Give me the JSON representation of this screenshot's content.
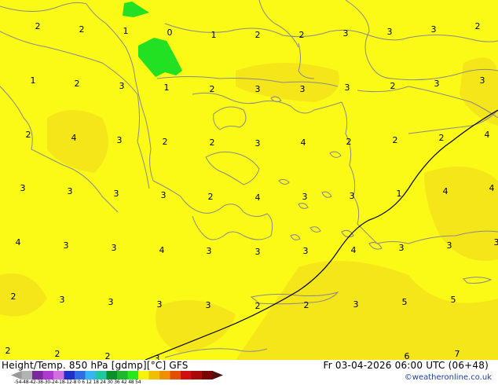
{
  "map": {
    "footer": {
      "title": "Height/Temp. 850 hPa [gdmp][°C] GFS",
      "valid": "Fr 03-04-2026 06:00 UTC (06+48)",
      "credit": "©weatheronline.co.uk",
      "colorbar_ticks": "-54-48-42-38-30-24-18-12-8  0  6  12 18 24 30 36 42 48 54"
    },
    "colorbar": {
      "colors": [
        "#9a9a9a",
        "#b3b3b3",
        "#7a2a9a",
        "#b03ad0",
        "#d070e0",
        "#1e30c8",
        "#2f6ee0",
        "#35b6f0",
        "#20c8a0",
        "#0a8f2a",
        "#1fb82c",
        "#26e81c",
        "#f5f50c",
        "#f0c000",
        "#f09000",
        "#e05000",
        "#d01010",
        "#a80a0a",
        "#7a0505",
        "#501010"
      ]
    },
    "colors": {
      "base": "#fafa16",
      "warm": "#f5e61a",
      "cold": "#22e022",
      "border": "#8a8a8a",
      "contour": "#000000"
    },
    "labels": [
      {
        "text": "2"
      },
      {
        "text": "2"
      },
      {
        "text": "1"
      },
      {
        "text": "0"
      },
      {
        "text": "1"
      },
      {
        "text": "2"
      },
      {
        "text": "2"
      },
      {
        "text": "3"
      },
      {
        "text": "3"
      },
      {
        "text": "3"
      },
      {
        "text": "2"
      },
      {
        "text": "1"
      },
      {
        "text": "2"
      },
      {
        "text": "3"
      },
      {
        "text": "1"
      },
      {
        "text": "2"
      },
      {
        "text": "3"
      },
      {
        "text": "3"
      },
      {
        "text": "3"
      },
      {
        "text": "2"
      },
      {
        "text": "3"
      },
      {
        "text": "3"
      },
      {
        "text": "2"
      },
      {
        "text": "4"
      },
      {
        "text": "3"
      },
      {
        "text": "2"
      },
      {
        "text": "2"
      },
      {
        "text": "3"
      },
      {
        "text": "4"
      },
      {
        "text": "2"
      },
      {
        "text": "2"
      },
      {
        "text": "2"
      },
      {
        "text": "4"
      },
      {
        "text": "3"
      },
      {
        "text": "3"
      },
      {
        "text": "3"
      },
      {
        "text": "3"
      },
      {
        "text": "2"
      },
      {
        "text": "4"
      },
      {
        "text": "3"
      },
      {
        "text": "3"
      },
      {
        "text": "1"
      },
      {
        "text": "4"
      },
      {
        "text": "4"
      },
      {
        "text": "4"
      },
      {
        "text": "3"
      },
      {
        "text": "3"
      },
      {
        "text": "4"
      },
      {
        "text": "3"
      },
      {
        "text": "3"
      },
      {
        "text": "3"
      },
      {
        "text": "4"
      },
      {
        "text": "3"
      },
      {
        "text": "3"
      },
      {
        "text": "3"
      },
      {
        "text": "2"
      },
      {
        "text": "3"
      },
      {
        "text": "3"
      },
      {
        "text": "3"
      },
      {
        "text": "3"
      },
      {
        "text": "2"
      },
      {
        "text": "2"
      },
      {
        "text": "3"
      },
      {
        "text": "5"
      },
      {
        "text": "5"
      },
      {
        "text": "2"
      },
      {
        "text": "2"
      },
      {
        "text": "2"
      },
      {
        "text": "3"
      },
      {
        "text": "6"
      },
      {
        "text": "7"
      }
    ]
  }
}
